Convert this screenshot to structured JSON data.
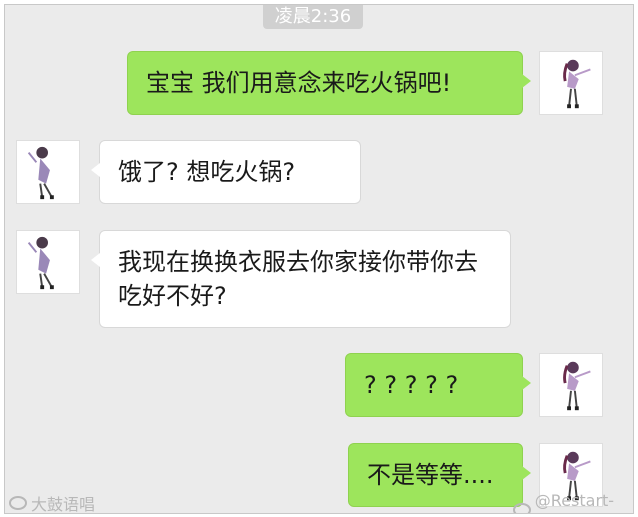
{
  "timestamp": "凌晨2:36",
  "messages": [
    {
      "side": "out",
      "text": "宝宝 我们用意念来吃火锅吧!"
    },
    {
      "side": "in",
      "text": "饿了? 想吃火锅?"
    },
    {
      "side": "in",
      "text": "我现在换换衣服去你家接你带你去吃好不好?"
    },
    {
      "side": "out",
      "text": "? ? ? ? ?"
    },
    {
      "side": "out",
      "text": "不是等等...."
    }
  ],
  "watermarks": {
    "left": "大鼓语唱",
    "right": "@Restart-99"
  },
  "colors": {
    "chat_background": "#ebebeb",
    "outgoing_bubble": "#9de55c",
    "incoming_bubble": "#ffffff",
    "timestamp_pill": "#d0d0d0"
  },
  "icons": {
    "sender_avatar": "anime-girl-dancing-avatar",
    "receiver_avatar": "anime-boy-dancing-avatar",
    "weibo": "weibo-icon"
  }
}
